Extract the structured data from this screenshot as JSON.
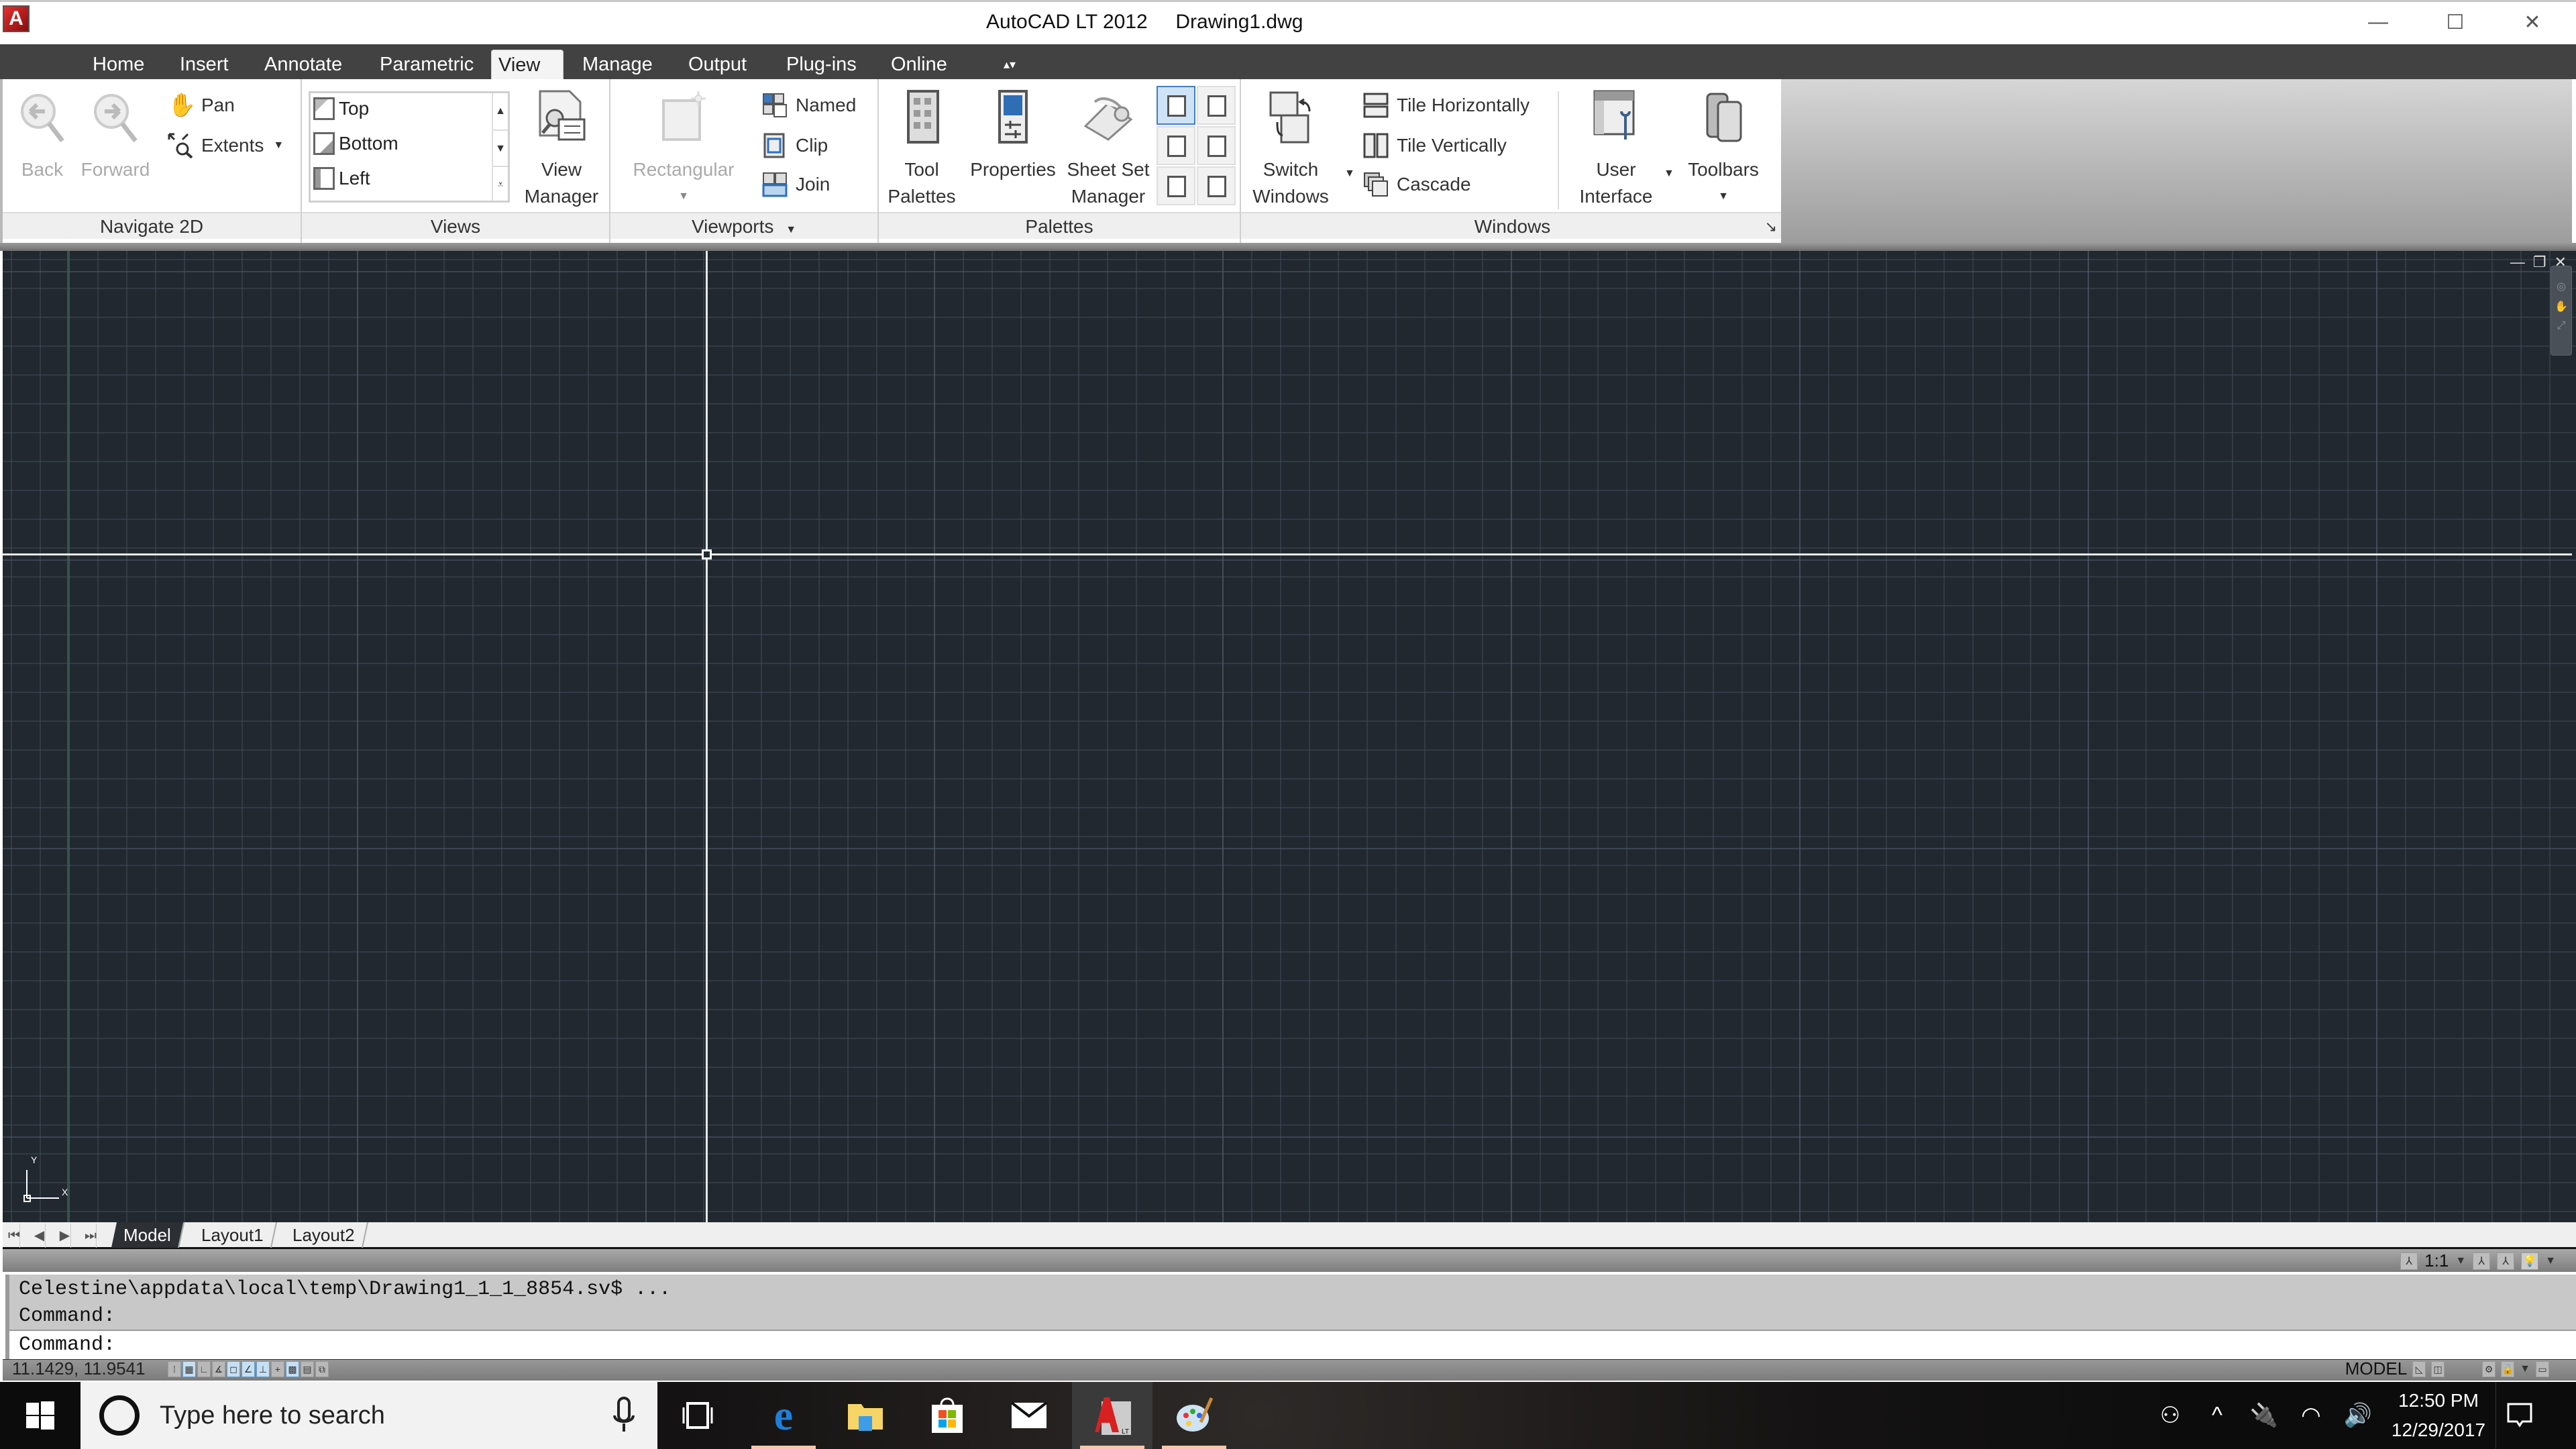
{
  "window": {
    "title": "AutoCAD LT 2012     Drawing1.dwg",
    "app_icon": "A",
    "controls": {
      "minimize": "—",
      "maximize": "☐",
      "close": "✕"
    }
  },
  "ribbon": {
    "tabs": [
      {
        "label": "Home",
        "active": false
      },
      {
        "label": "Insert",
        "active": false
      },
      {
        "label": "Annotate",
        "active": false
      },
      {
        "label": "Parametric",
        "active": false
      },
      {
        "label": "View",
        "active": true
      },
      {
        "label": "Manage",
        "active": false
      },
      {
        "label": "Output",
        "active": false
      },
      {
        "label": "Plug-ins",
        "active": false
      },
      {
        "label": "Online",
        "active": false
      }
    ],
    "minimize_toggle": "▴▾",
    "panels": {
      "navigate": {
        "label": "Navigate 2D",
        "back": "Back",
        "forward": "Forward",
        "pan": "Pan",
        "extents": "Extents"
      },
      "views": {
        "label": "Views",
        "items": [
          "Top",
          "Bottom",
          "Left"
        ],
        "view_manager_line1": "View",
        "view_manager_line2": "Manager"
      },
      "viewports": {
        "label": "Viewports",
        "rectangular": "Rectangular",
        "named": "Named",
        "clip": "Clip",
        "join": "Join"
      },
      "palettes": {
        "label": "Palettes",
        "tool_palettes_line1": "Tool",
        "tool_palettes_line2": "Palettes",
        "properties": "Properties",
        "sheet_set_line1": "Sheet Set",
        "sheet_set_line2": "Manager"
      },
      "windows": {
        "label": "Windows",
        "switch_line1": "Switch",
        "switch_line2": "Windows",
        "tile_h": "Tile Horizontally",
        "tile_v": "Tile Vertically",
        "cascade": "Cascade",
        "ui_line1": "User",
        "ui_line2": "Interface",
        "toolbars": "Toolbars",
        "launcher": "↘"
      }
    }
  },
  "drawing": {
    "ucs_x": "X",
    "ucs_y": "Y",
    "viewport_controls": [
      "—",
      "❐",
      "✕"
    ]
  },
  "layout_tabs": {
    "nav": [
      "⏮",
      "◀",
      "▶",
      "⏭"
    ],
    "tabs": [
      {
        "label": "Model",
        "active": true
      },
      {
        "label": "Layout1",
        "active": false
      },
      {
        "label": "Layout2",
        "active": false
      }
    ]
  },
  "annotation": {
    "scale": "1:1"
  },
  "command": {
    "history": [
      "Celestine\\appdata\\local\\temp\\Drawing1_1_1_8854.sv$ ...",
      "Command:"
    ],
    "prompt": "Command:"
  },
  "statusbar": {
    "coordinates": "11.1429, 11.9541",
    "toggles": [
      {
        "name": "infer-constraints",
        "glyph": "⁞",
        "on": false
      },
      {
        "name": "snap-mode",
        "glyph": "▦",
        "on": true
      },
      {
        "name": "ortho-mode",
        "glyph": "∟",
        "on": false
      },
      {
        "name": "polar-tracking",
        "glyph": "∡",
        "on": false
      },
      {
        "name": "object-snap",
        "glyph": "◻",
        "on": true
      },
      {
        "name": "object-snap-tracking",
        "glyph": "∠",
        "on": true
      },
      {
        "name": "dynamic-ucs",
        "glyph": "⊥",
        "on": true
      },
      {
        "name": "dynamic-input",
        "glyph": "+",
        "on": false
      },
      {
        "name": "lineweight",
        "glyph": "▩",
        "on": true
      },
      {
        "name": "quick-properties",
        "glyph": "▤",
        "on": false
      },
      {
        "name": "selection-cycling",
        "glyph": "⧉",
        "on": false
      }
    ],
    "space": "MODEL"
  },
  "taskbar": {
    "search_placeholder": "Type here to search",
    "time": "12:50 PM",
    "date": "12/29/2017",
    "apps": [
      "task-view",
      "edge",
      "file-explorer",
      "store",
      "mail",
      "autocad-lt",
      "paint"
    ]
  },
  "colors": {
    "drawing_bg": "#212830",
    "ribbon_tab_bar": "#424242",
    "crosshair": "#e8e8e8",
    "accent_blue": "#3c7fc8"
  }
}
